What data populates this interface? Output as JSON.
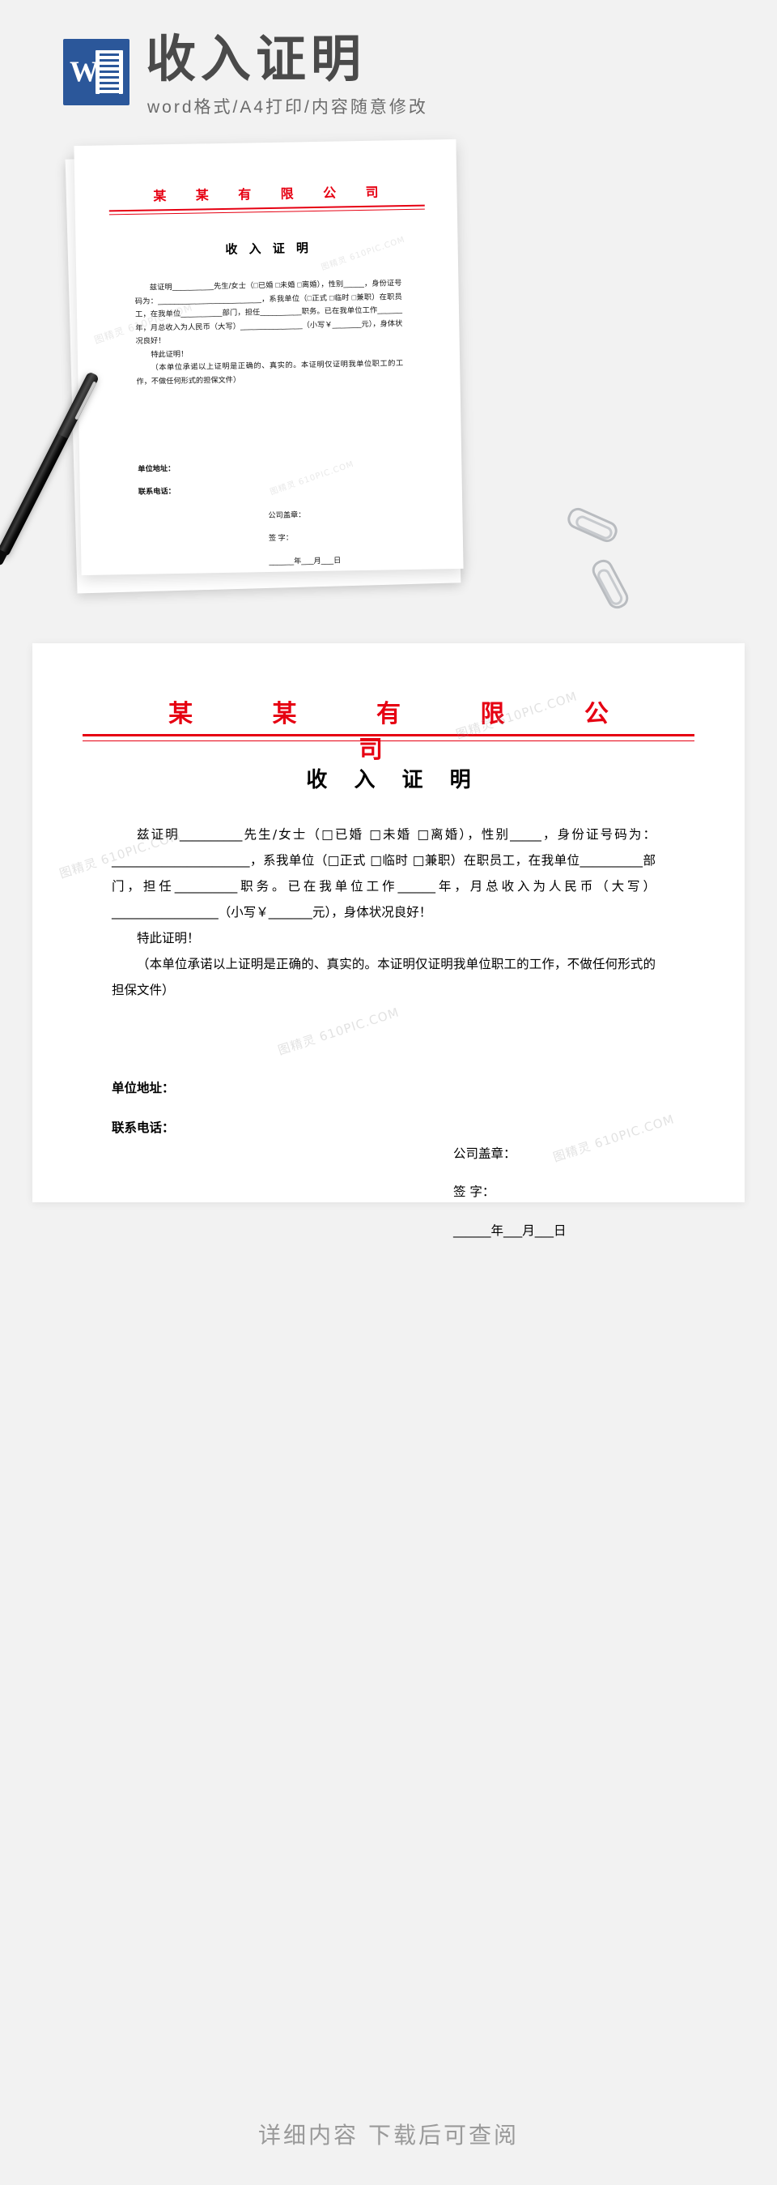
{
  "banner": {
    "title": "收入证明",
    "subtitle": "word格式/A4打印/内容随意修改",
    "logo_letter": "W",
    "logo_icon": "word-document-icon"
  },
  "document": {
    "company_line": "某 某 有 限 公 司",
    "title": "收 入 证 明",
    "body": [
      "兹证明__________先生/女士（□已婚 □未婚 □离婚），性别_____，身份证号码为：______________________，系我单位（□正式 □临时 □兼职）在职员工，在我单位__________部门，担任__________职务。已在我单位工作______年，月总收入为人民币（大写）_________________（小写￥_______元），身体状况良好！",
      "特此证明！",
      "（本单位承诺以上证明是正确的、真实的。本证明仅证明我单位职工的工作，不做任何形式的担保文件）"
    ],
    "footer_fields": [
      "单位地址：",
      "联系电话："
    ],
    "signature_block": [
      "公司盖章：",
      "签  字：",
      "______年___月___日"
    ]
  },
  "preview": {
    "company_line": "某 某 有 限 公 司",
    "title": "收 入 证 明",
    "body": [
      "兹证明__________先生/女士（□已婚 □未婚 □离婚），性别_____，身份证号码为：_________________________，系我单位（□正式 □临时 □兼职）在职员工，在我单位__________部门，担任__________职务。已在我单位工作______年，月总收入为人民币（大写）_______________（小写￥_______元），身体状况良好！",
      "特此证明！",
      "（本单位承诺以上证明是正确的、真实的。本证明仅证明我单位职工的工作，不做任何形式的担保文件）"
    ],
    "footer_fields": [
      "单位地址：",
      "联系电话："
    ],
    "signature_block": [
      "公司盖章：",
      "签  字：",
      "______年___月___日"
    ]
  },
  "footer": {
    "text": "详细内容 下载后可查阅"
  },
  "watermark": {
    "text": "图精灵 610PIC.COM"
  },
  "colors": {
    "brand_red": "#e60012",
    "word_blue": "#2b579a",
    "page_background": "#f2f2f2",
    "banner_title": "#4a4a4a",
    "footer_text": "#9a9a9a"
  }
}
